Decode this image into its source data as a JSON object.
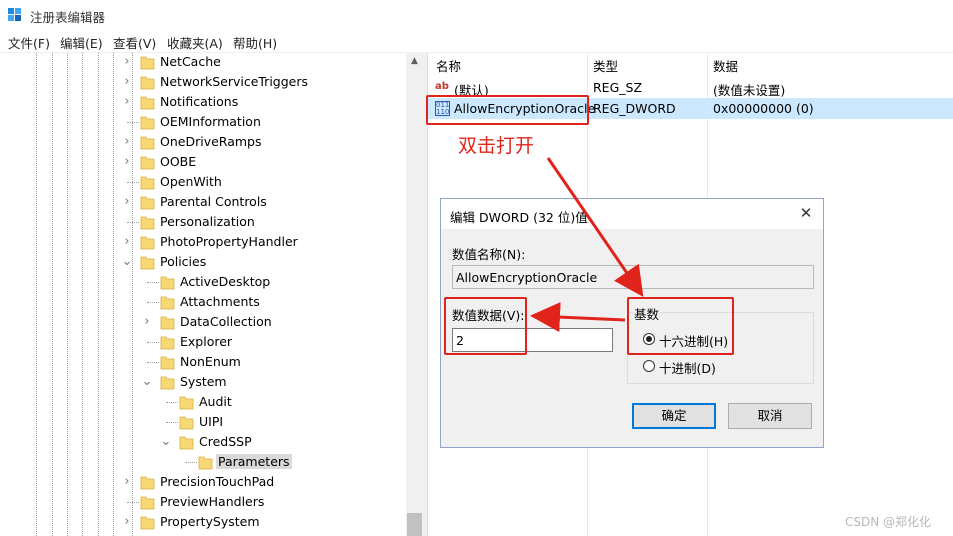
{
  "window": {
    "title": "注册表编辑器"
  },
  "menu": [
    "文件(F)",
    "编辑(E)",
    "查看(V)",
    "收藏夹(A)",
    "帮助(H)"
  ],
  "tree": [
    {
      "label": "NetCache",
      "expander": "collapsed"
    },
    {
      "label": "NetworkServiceTriggers",
      "expander": "collapsed"
    },
    {
      "label": "Notifications",
      "expander": "collapsed"
    },
    {
      "label": "OEMInformation",
      "expander": "none"
    },
    {
      "label": "OneDriveRamps",
      "expander": "collapsed"
    },
    {
      "label": "OOBE",
      "expander": "collapsed"
    },
    {
      "label": "OpenWith",
      "expander": "none"
    },
    {
      "label": "Parental Controls",
      "expander": "collapsed"
    },
    {
      "label": "Personalization",
      "expander": "none"
    },
    {
      "label": "PhotoPropertyHandler",
      "expander": "collapsed"
    },
    {
      "label": "Policies",
      "expander": "expanded"
    },
    {
      "label": "ActiveDesktop",
      "expander": "none"
    },
    {
      "label": "Attachments",
      "expander": "none"
    },
    {
      "label": "DataCollection",
      "expander": "collapsed"
    },
    {
      "label": "Explorer",
      "expander": "none"
    },
    {
      "label": "NonEnum",
      "expander": "none"
    },
    {
      "label": "System",
      "expander": "expanded"
    },
    {
      "label": "Audit",
      "expander": "none"
    },
    {
      "label": "UIPI",
      "expander": "none"
    },
    {
      "label": "CredSSP",
      "expander": "expanded"
    },
    {
      "label": "Parameters",
      "expander": "none",
      "selected": true
    },
    {
      "label": "PrecisionTouchPad",
      "expander": "collapsed"
    },
    {
      "label": "PreviewHandlers",
      "expander": "none"
    },
    {
      "label": "PropertySystem",
      "expander": "collapsed"
    }
  ],
  "values_pane": {
    "headers": {
      "name": "名称",
      "type": "类型",
      "data": "数据"
    },
    "rows": [
      {
        "icon": "string-value-icon",
        "name": "(默认)",
        "type": "REG_SZ",
        "data": "(数值未设置)"
      },
      {
        "icon": "binary-value-icon",
        "name": "AllowEncryptionOracle",
        "type": "REG_DWORD",
        "data": "0x00000000 (0)",
        "selected": true
      }
    ]
  },
  "annotation": {
    "text": "双击打开",
    "color": "#e0241c"
  },
  "dialog": {
    "title": "编辑 DWORD (32 位)值",
    "name_label": "数值名称(N):",
    "name_value": "AllowEncryptionOracle",
    "data_label": "数值数据(V):",
    "data_value": "2",
    "base_label": "基数",
    "radio_hex": "十六进制(H)",
    "radio_dec": "十进制(D)",
    "radio_selected": "hex",
    "ok_label": "确定",
    "cancel_label": "取消"
  },
  "watermark": "CSDN @郑化化",
  "colors": {
    "selection": "#cce8ff",
    "accent": "#0078d7",
    "annotation": "#e0241c"
  }
}
